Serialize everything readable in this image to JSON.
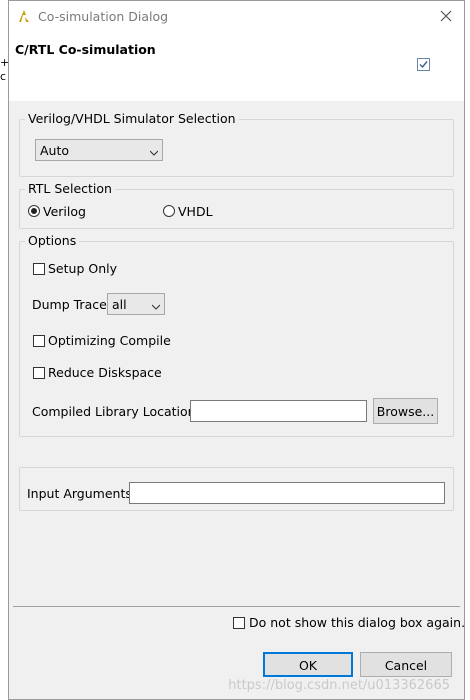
{
  "window": {
    "title": "Co-simulation Dialog",
    "header_title": "C/RTL Co-simulation"
  },
  "simulator_selection": {
    "group_label": "Verilog/VHDL Simulator Selection",
    "selected": "Auto"
  },
  "rtl_selection": {
    "group_label": "RTL Selection",
    "options": [
      {
        "label": "Verilog",
        "selected": true
      },
      {
        "label": "VHDL",
        "selected": false
      }
    ]
  },
  "options": {
    "group_label": "Options",
    "setup_only_label": "Setup Only",
    "setup_only_checked": false,
    "dump_trace_label": "Dump Trace",
    "dump_trace_value": "all",
    "optimizing_compile_label": "Optimizing Compile",
    "optimizing_compile_checked": false,
    "reduce_diskspace_label": "Reduce Diskspace",
    "reduce_diskspace_checked": false,
    "compiled_library_label": "Compiled Library Location",
    "compiled_library_value": "",
    "browse_label": "Browse..."
  },
  "input_arguments": {
    "label": "Input Arguments",
    "value": ""
  },
  "footer": {
    "dont_show_label": "Do not show this dialog box again.",
    "dont_show_checked": false,
    "ok_label": "OK",
    "cancel_label": "Cancel"
  },
  "watermark": "https://blog.csdn.net/u013362665",
  "colors": {
    "default_button_border": "#0078d7",
    "dialog_background": "#f0f0f0",
    "header_background": "#ffffff",
    "app_icon": "#c8a000"
  },
  "icons": {
    "app_icon": "vivado-hls-icon",
    "close": "close-icon",
    "header_check": "checkbox-icon"
  }
}
